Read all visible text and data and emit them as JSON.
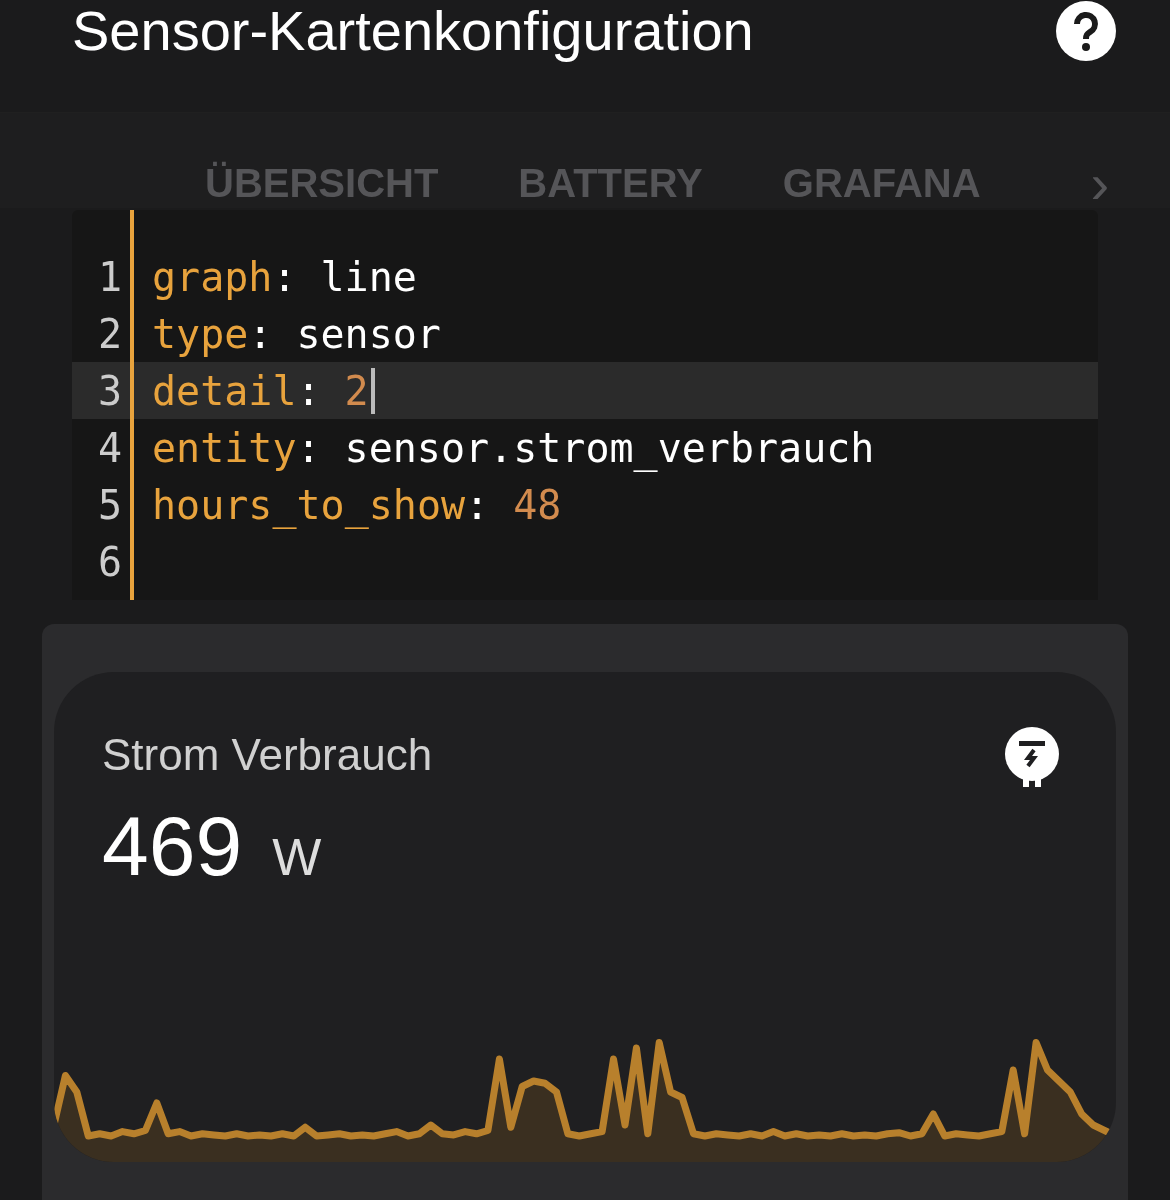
{
  "dialog": {
    "title": "Sensor-Kartenkonfiguration"
  },
  "tabs": [
    {
      "label": "ÜBERSICHT"
    },
    {
      "label": "BATTERY"
    },
    {
      "label": "GRAFANA"
    }
  ],
  "tabs_next": "›",
  "editor": {
    "lines": [
      {
        "number": "1",
        "key": "graph",
        "separator": ":",
        "value": "line",
        "kind": "string",
        "selected": false
      },
      {
        "number": "2",
        "key": "type",
        "separator": ":",
        "value": "sensor",
        "kind": "string",
        "selected": false
      },
      {
        "number": "3",
        "key": "detail",
        "separator": ":",
        "value": "2",
        "kind": "number",
        "selected": true
      },
      {
        "number": "4",
        "key": "entity",
        "separator": ":",
        "value": "sensor.strom_verbrauch",
        "kind": "string",
        "selected": false
      },
      {
        "number": "5",
        "key": "hours_to_show",
        "separator": ":",
        "value": "48",
        "kind": "number",
        "selected": false
      },
      {
        "number": "6",
        "selected": false
      }
    ]
  },
  "card": {
    "name": "Strom Verbrauch",
    "value": "469",
    "unit": "W"
  }
}
